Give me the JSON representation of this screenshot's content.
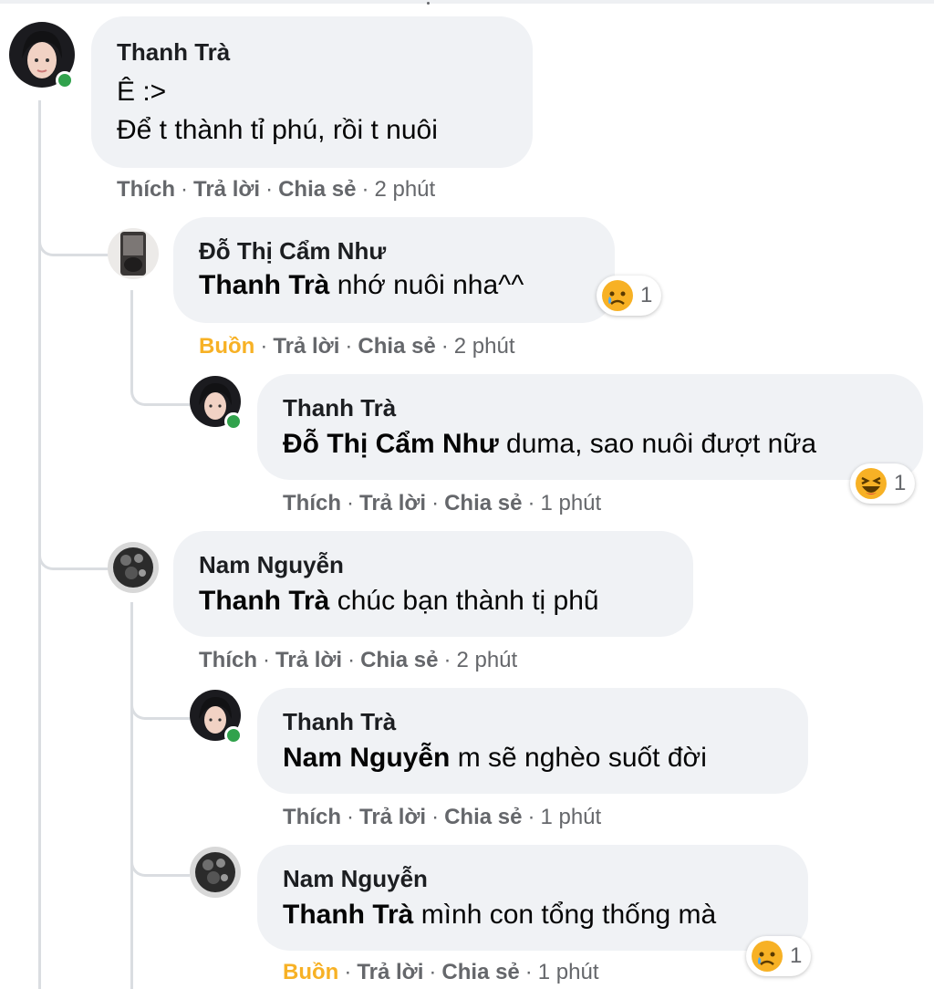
{
  "comments": [
    {
      "author": "Thanh Trà",
      "lines": [
        "Ê :>",
        "Để t thành tỉ phú, rồi t nuôi"
      ],
      "actions": {
        "like": "Thích",
        "reply": "Trả lời",
        "share": "Chia sẻ",
        "time": "2 phút"
      }
    },
    {
      "author": "Đỗ Thị Cẩm Như",
      "mention": "Thanh Trà",
      "text": " nhớ nuôi nha^^",
      "actions": {
        "reaction": "Buồn",
        "reply": "Trả lời",
        "share": "Chia sẻ",
        "time": "2 phút"
      },
      "reaction": {
        "type": "sad",
        "count": "1"
      }
    },
    {
      "author": "Thanh Trà",
      "mention": "Đỗ Thị Cẩm Như",
      "text": " duma, sao nuôi đượt nữa",
      "actions": {
        "like": "Thích",
        "reply": "Trả lời",
        "share": "Chia sẻ",
        "time": "1 phút"
      },
      "reaction": {
        "type": "haha",
        "count": "1"
      }
    },
    {
      "author": "Nam Nguyễn",
      "mention": "Thanh Trà",
      "text": " chúc bạn thành tị phũ",
      "actions": {
        "like": "Thích",
        "reply": "Trả lời",
        "share": "Chia sẻ",
        "time": "2 phút"
      }
    },
    {
      "author": "Thanh Trà",
      "mention": "Nam Nguyễn",
      "text": " m sẽ nghèo suốt đời",
      "actions": {
        "like": "Thích",
        "reply": "Trả lời",
        "share": "Chia sẻ",
        "time": "1 phút"
      }
    },
    {
      "author": "Nam Nguyễn",
      "mention": "Thanh Trà",
      "text": " mình con tổng thống mà",
      "actions": {
        "reaction": "Buồn",
        "reply": "Trả lời",
        "share": "Chia sẻ",
        "time": "1 phút"
      },
      "reaction": {
        "type": "sad",
        "count": "1"
      }
    }
  ],
  "separator": "·",
  "colors": {
    "bubble": "#f0f2f5",
    "online": "#31a24c",
    "reaction_sad": "#f7b125",
    "meta": "#65676b"
  }
}
